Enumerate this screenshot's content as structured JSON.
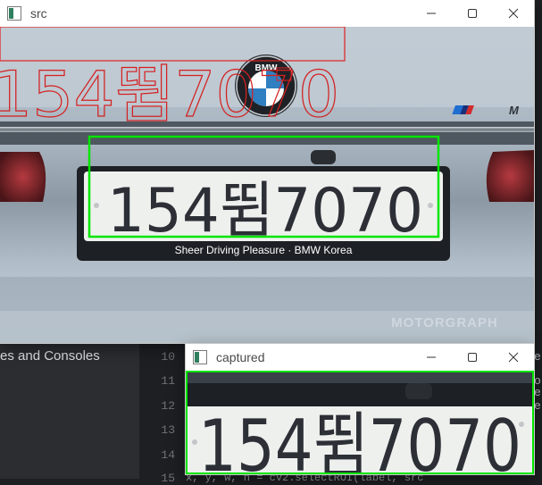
{
  "ide": {
    "explorer_fragment": "es and Consoles",
    "line_numbers": [
      "10",
      "11",
      "12",
      "13",
      "14",
      "15"
    ],
    "right_fragments": [
      "e",
      "o",
      "e",
      "e"
    ],
    "bottom_code": "x, y, w, h = cv2.selectROI(label, src"
  },
  "src_window": {
    "title": "src",
    "overlay_text": "154뜀7070",
    "plate_text": "154뜀7070",
    "plate_frame_text": "Sheer Driving Pleasure · BMW Korea",
    "badge_text": "M",
    "brand_text": "BMW",
    "watermark_text": "MOTORGRAPH",
    "colors": {
      "roi_box": "#00e600",
      "overlay_text": "#d42020",
      "overlay_box": "#e02020",
      "car_paint": "#a8b6c2",
      "plate_bg": "#eef0ee",
      "plate_text": "#2c3036"
    }
  },
  "captured_window": {
    "title": "captured",
    "plate_text": "154뜀7070",
    "colors": {
      "border": "#00e600"
    }
  }
}
